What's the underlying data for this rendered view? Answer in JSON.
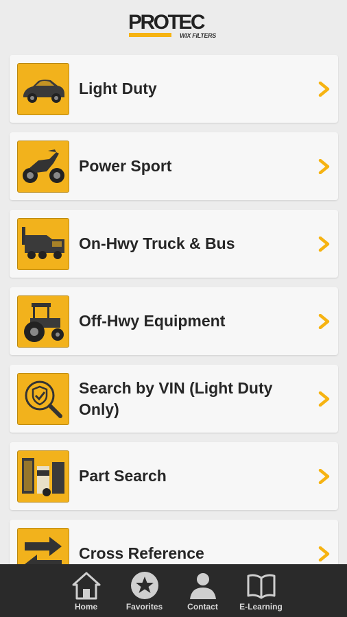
{
  "header": {
    "logo_main": "PROTEC",
    "logo_sub": "WIX FILTERS"
  },
  "colors": {
    "accent": "#f6b312",
    "tile": "#f2b21c",
    "card": "#f7f7f7",
    "background": "#ececec",
    "tabbar": "#2a2a2a"
  },
  "menu": {
    "items": [
      {
        "label": "Light Duty",
        "icon": "car-icon"
      },
      {
        "label": "Power Sport",
        "icon": "motorcycle-icon"
      },
      {
        "label": "On-Hwy Truck & Bus",
        "icon": "truck-icon"
      },
      {
        "label": "Off-Hwy Equipment",
        "icon": "tractor-icon"
      },
      {
        "label": "Search by VIN (Light Duty Only)",
        "icon": "vin-search-icon"
      },
      {
        "label": "Part Search",
        "icon": "filter-parts-icon"
      },
      {
        "label": "Cross Reference",
        "icon": "cross-reference-icon"
      }
    ]
  },
  "tabbar": {
    "tabs": [
      {
        "label": "Home",
        "icon": "home-icon"
      },
      {
        "label": "Favorites",
        "icon": "star-icon"
      },
      {
        "label": "Contact",
        "icon": "person-icon"
      },
      {
        "label": "E-Learning",
        "icon": "book-icon"
      }
    ]
  }
}
